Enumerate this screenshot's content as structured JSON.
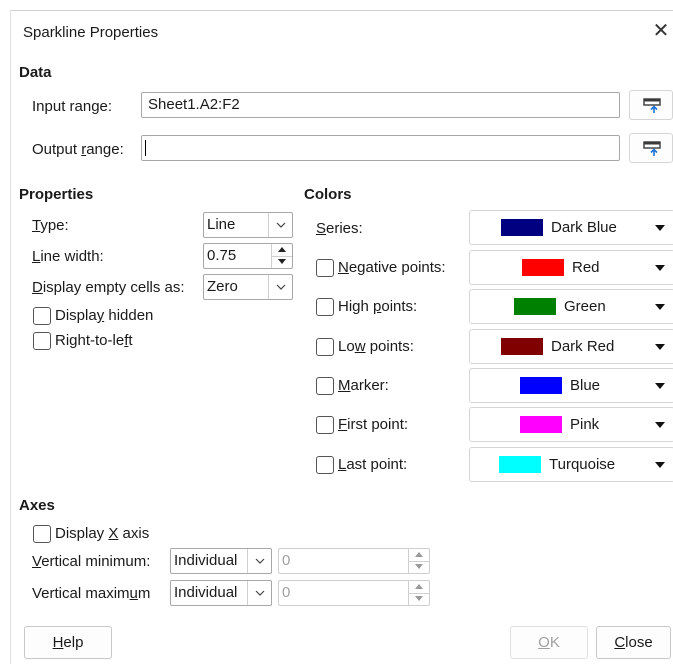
{
  "window": {
    "title": "Sparkline Properties"
  },
  "data_section": {
    "heading": "Data",
    "input_range": {
      "label_pre": "Input range:",
      "value": "Sheet1.A2:F2"
    },
    "output_range": {
      "label_pre": "Output ",
      "label_acc": "r",
      "label_post": "ange:",
      "value": ""
    }
  },
  "properties": {
    "heading": "Properties",
    "type": {
      "acc": "T",
      "rest": "ype:",
      "value": "Line"
    },
    "line_width": {
      "acc": "L",
      "rest": "ine width:",
      "value": "0.75"
    },
    "empty_cells": {
      "acc": "D",
      "rest": "isplay empty cells as:",
      "value": "Zero"
    },
    "display_hidden": {
      "pre": "Displa",
      "acc": "y",
      "post": " hidden",
      "checked": false
    },
    "right_to_left": {
      "pre": "Right-to-le",
      "acc": "f",
      "post": "t",
      "checked": false
    }
  },
  "colors": {
    "heading": "Colors",
    "series": {
      "acc": "S",
      "rest": "eries:",
      "color_name": "Dark Blue",
      "hex": "#000080"
    },
    "negative": {
      "pre": "",
      "acc": "N",
      "post": "egative points:",
      "checked": false,
      "color_name": "Red",
      "hex": "#ff0000"
    },
    "high": {
      "pre": "High ",
      "acc": "p",
      "post": "oints:",
      "checked": false,
      "color_name": "Green",
      "hex": "#008000"
    },
    "low": {
      "pre": "Lo",
      "acc": "w",
      "post": " points:",
      "checked": false,
      "color_name": "Dark Red",
      "hex": "#800000"
    },
    "marker": {
      "pre": "",
      "acc": "M",
      "post": "arker:",
      "checked": false,
      "color_name": "Blue",
      "hex": "#0000ff"
    },
    "first": {
      "pre": "",
      "acc": "F",
      "post": "irst point:",
      "checked": false,
      "color_name": "Pink",
      "hex": "#ff00ff"
    },
    "last": {
      "pre": "",
      "acc": "L",
      "post": "ast point:",
      "checked": false,
      "color_name": "Turquoise",
      "hex": "#00ffff"
    }
  },
  "axes": {
    "heading": "Axes",
    "display_x": {
      "pre": "Display ",
      "acc": "X",
      "post": " axis",
      "checked": false
    },
    "vmin": {
      "acc": "V",
      "rest": "ertical minimum:",
      "mode": "Individual",
      "value": "0"
    },
    "vmax": {
      "pre": "Vertical maxim",
      "acc": "u",
      "post": "m",
      "mode": "Individual",
      "value": "0"
    }
  },
  "buttons": {
    "help": {
      "acc": "H",
      "rest": "elp"
    },
    "ok": {
      "acc": "O",
      "rest": "K"
    },
    "close": {
      "acc": "C",
      "rest": "lose"
    }
  }
}
